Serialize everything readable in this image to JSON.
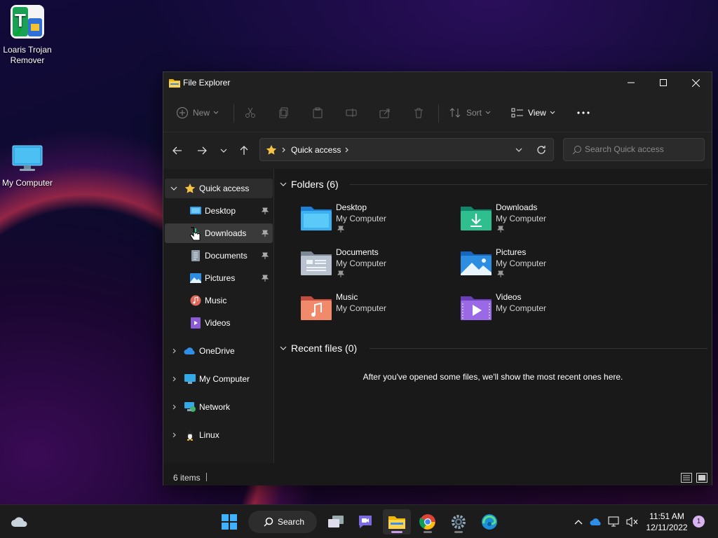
{
  "desktop": {
    "icons": [
      {
        "label": "Loaris Trojan Remover",
        "icon": "loaris-app-icon"
      },
      {
        "label": "My Computer",
        "icon": "monitor-icon"
      }
    ]
  },
  "window": {
    "title": "File Explorer",
    "toolbar": {
      "new_label": "New",
      "sort_label": "Sort",
      "view_label": "View"
    },
    "address": {
      "crumb": "Quick access"
    },
    "search": {
      "placeholder": "Search Quick access"
    },
    "nav_pane": {
      "quick_access": "Quick access",
      "pinned": [
        {
          "label": "Desktop",
          "pinned": true
        },
        {
          "label": "Downloads",
          "pinned": true
        },
        {
          "label": "Documents",
          "pinned": true
        },
        {
          "label": "Pictures",
          "pinned": true
        },
        {
          "label": "Music",
          "pinned": false
        },
        {
          "label": "Videos",
          "pinned": false
        }
      ],
      "roots": [
        {
          "label": "OneDrive"
        },
        {
          "label": "My Computer"
        },
        {
          "label": "Network"
        },
        {
          "label": "Linux"
        }
      ]
    },
    "content": {
      "folders_heading": "Folders (6)",
      "folders": [
        {
          "name": "Desktop",
          "location": "My Computer",
          "pinned": true
        },
        {
          "name": "Downloads",
          "location": "My Computer",
          "pinned": true
        },
        {
          "name": "Documents",
          "location": "My Computer",
          "pinned": true
        },
        {
          "name": "Pictures",
          "location": "My Computer",
          "pinned": true
        },
        {
          "name": "Music",
          "location": "My Computer",
          "pinned": false
        },
        {
          "name": "Videos",
          "location": "My Computer",
          "pinned": false
        }
      ],
      "recent_heading": "Recent files (0)",
      "recent_empty": "After you've opened some files, we'll show the most recent ones here."
    },
    "status": {
      "items": "6 items"
    }
  },
  "taskbar": {
    "search_label": "Search",
    "time": "11:51 AM",
    "date": "12/11/2022",
    "notifications": "1"
  },
  "colors": {
    "accent": "#c79be6",
    "window_bg": "#191919",
    "chrome_bg": "#202020"
  }
}
